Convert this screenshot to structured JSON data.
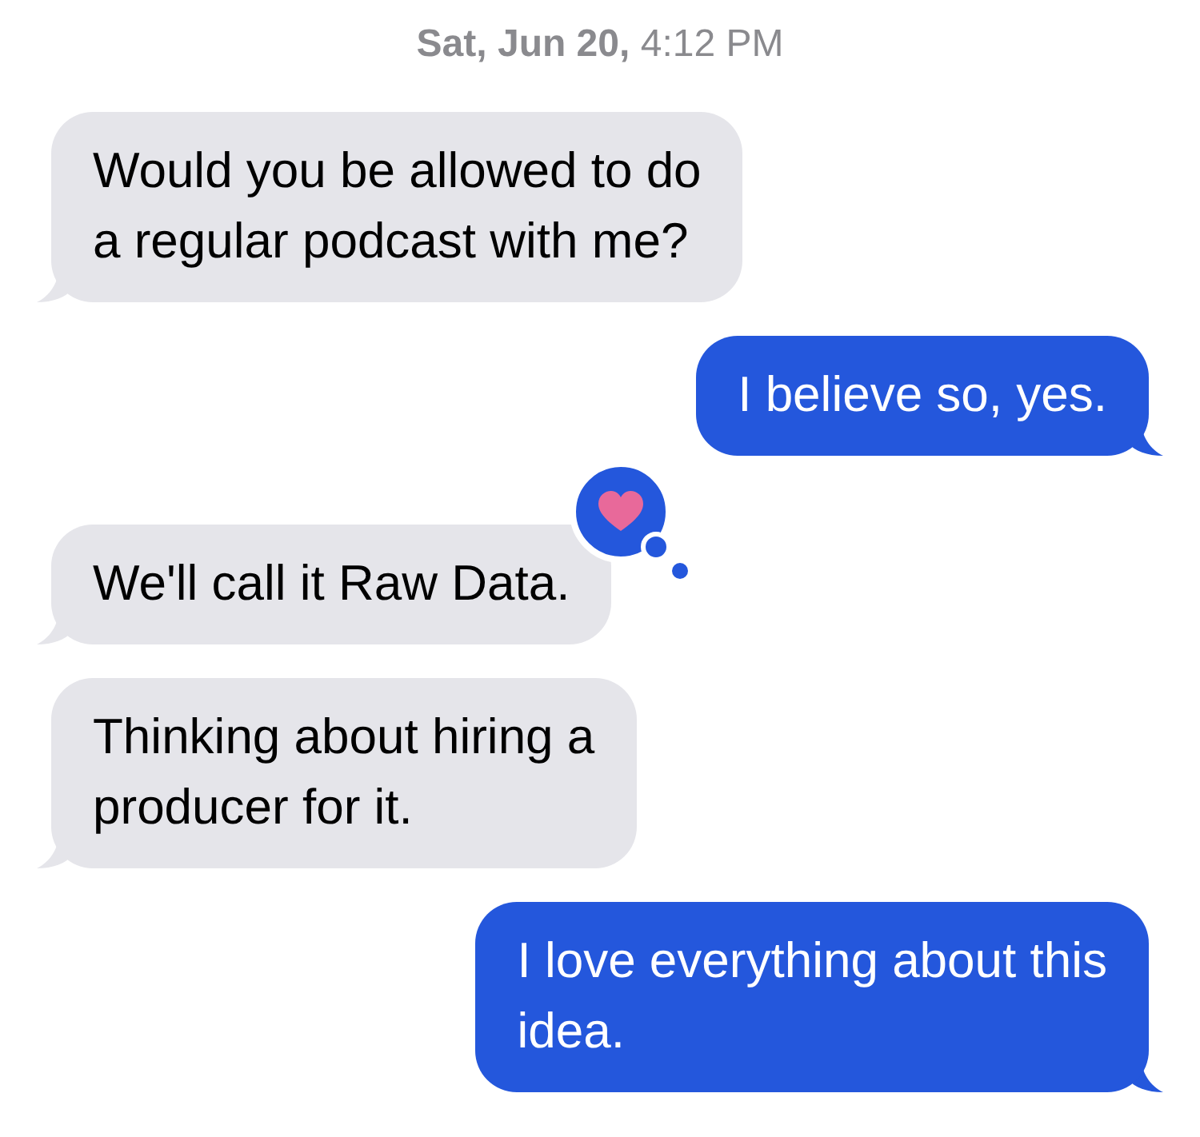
{
  "timestamp": "**Sat, Jun 20,** 4:12 PM",
  "messages": [
    {
      "kind": "incoming",
      "text": "Would you be allowed to do\na regular podcast with me?"
    },
    {
      "kind": "outgoing",
      "text": "I believe so, yes."
    },
    {
      "kind": "incoming",
      "text": "We'll call it Raw Data.",
      "tapback": {
        "kind": "heart"
      }
    },
    {
      "kind": "incoming",
      "text": "Thinking about hiring a\nproducer for it."
    },
    {
      "kind": "outgoing",
      "text": "I love everything about this\nidea."
    }
  ]
}
